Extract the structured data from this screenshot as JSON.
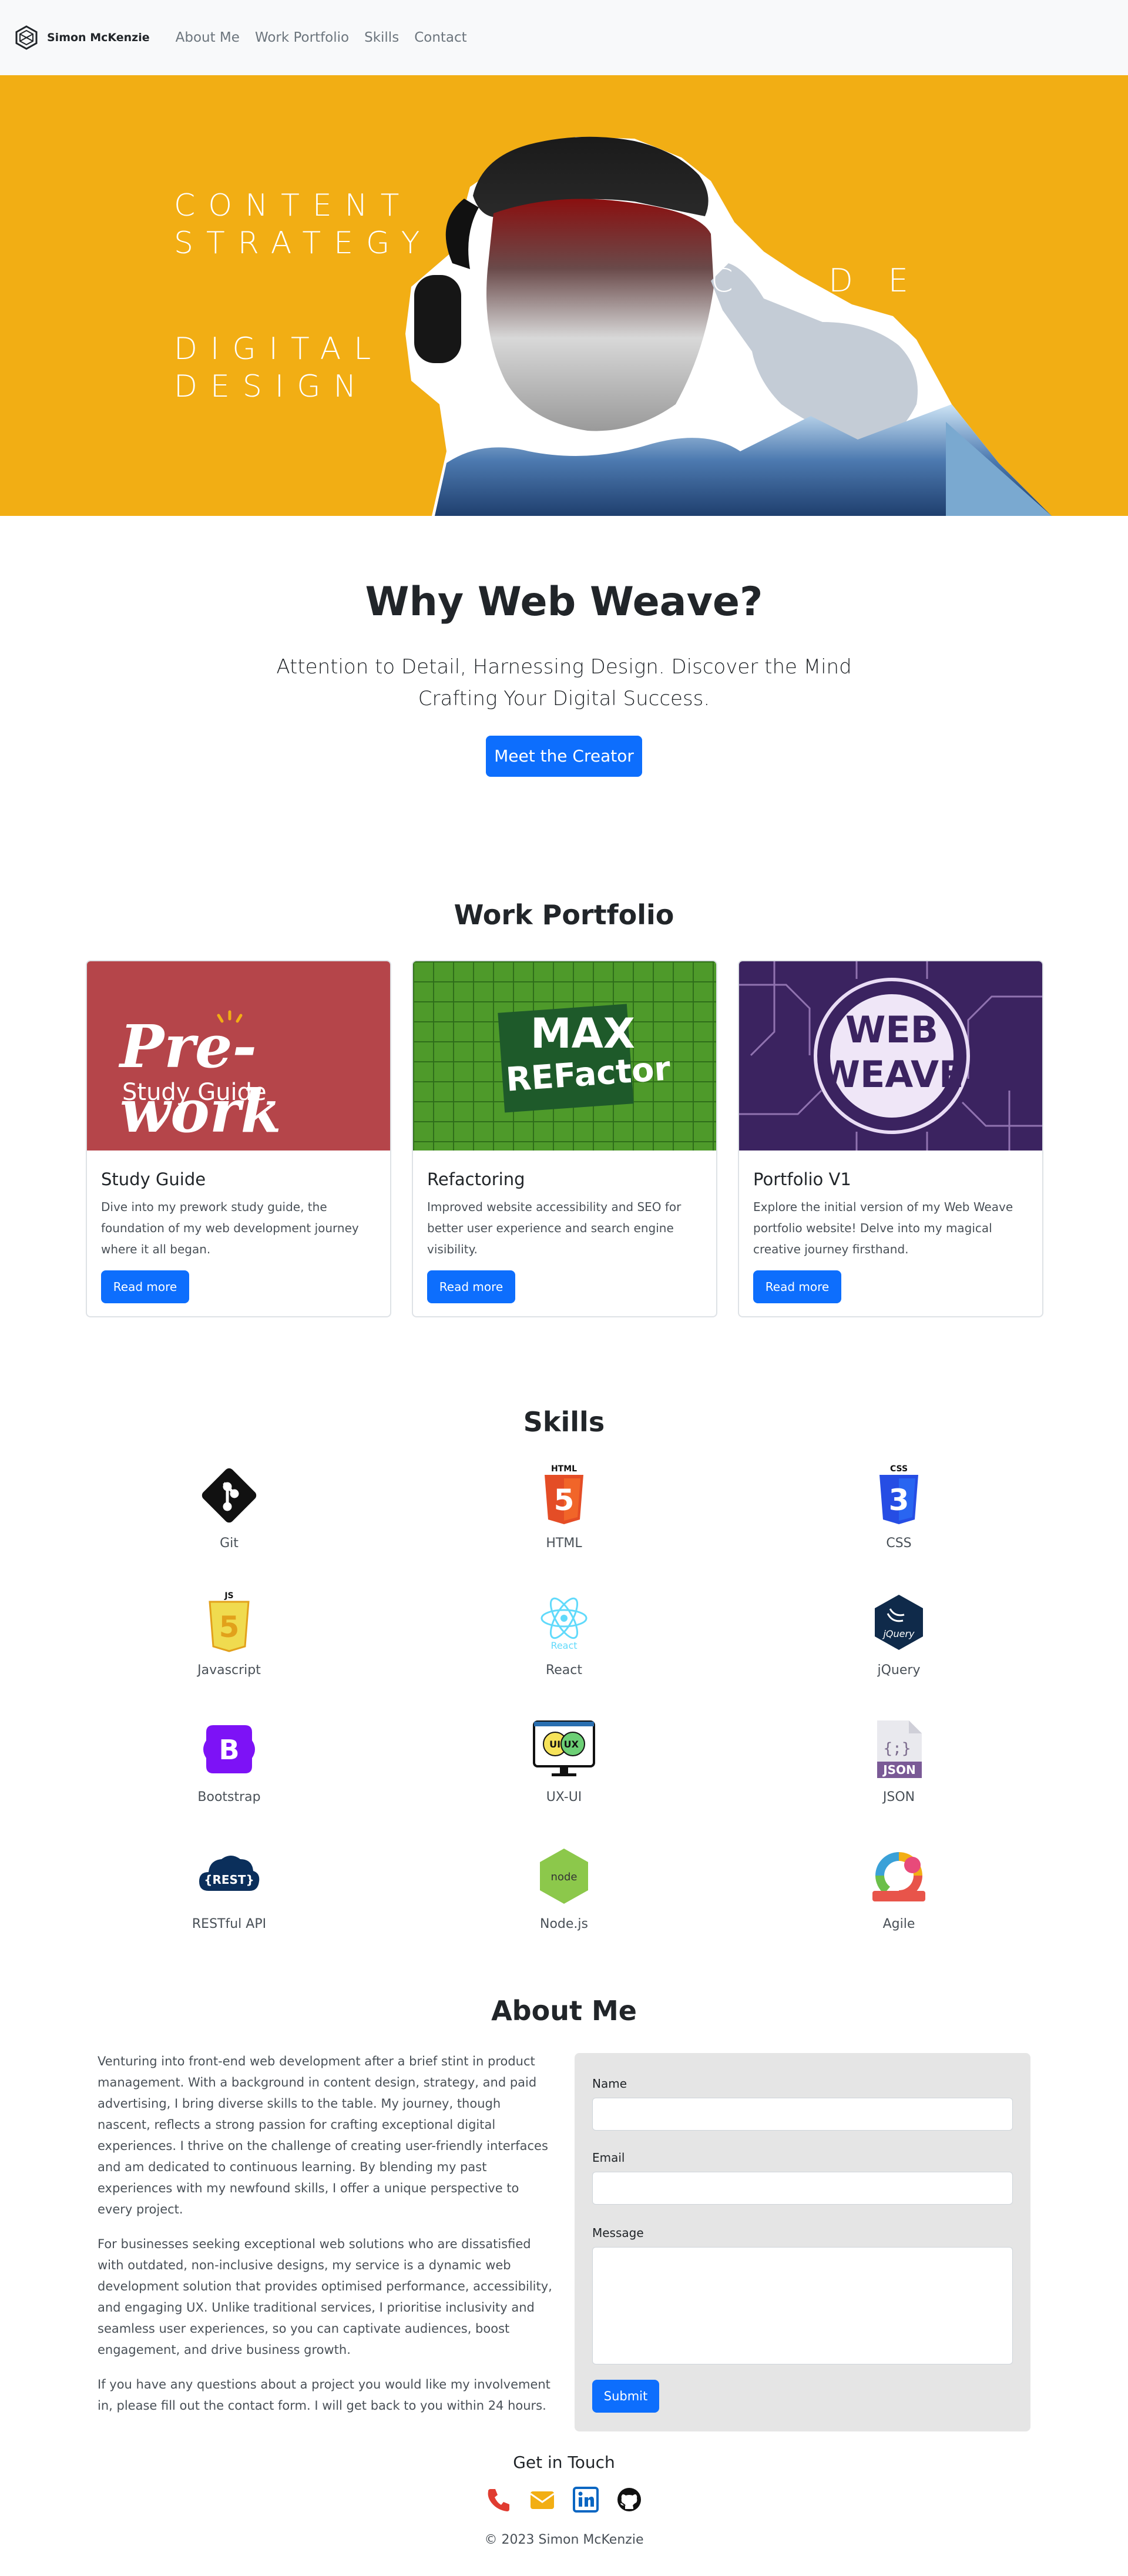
{
  "nav": {
    "brand": "Simon McKenzie",
    "links": [
      "About Me",
      "Work Portfolio",
      "Skills",
      "Contact"
    ]
  },
  "hero": {
    "word1": "CONTENT\nSTRATEGY",
    "word2": "DIGITAL\nDESIGN",
    "word3": "CODE"
  },
  "why": {
    "title": "Why Web Weave?",
    "subtitle": "Attention to Detail, Harnessing Design. Discover the Mind Crafting Your Digital Success.",
    "button": "Meet the Creator"
  },
  "portfolio": {
    "title": "Work Portfolio",
    "cards": [
      {
        "image_text1": "Pre-work",
        "image_text2": "Study Guide",
        "title": "Study Guide",
        "text": "Dive into my prework study guide, the foundation of my web development journey where it all began.",
        "button": "Read more"
      },
      {
        "image_text1": "MAX",
        "image_text2": "REFactor",
        "title": "Refactoring",
        "text": "Improved website accessibility and SEO for better user experience and search engine visibility.",
        "button": "Read more"
      },
      {
        "image_text1": "WEB",
        "image_text2": "WEAVE",
        "title": "Portfolio V1",
        "text": "Explore the initial version of my Web Weave portfolio website! Delve into my magical creative journey firsthand.",
        "button": "Read more"
      }
    ]
  },
  "skills": {
    "title": "Skills",
    "items": [
      {
        "label": "Git",
        "icon": "git-icon",
        "badge": ""
      },
      {
        "label": "HTML",
        "icon": "html5-icon",
        "badge": "HTML"
      },
      {
        "label": "CSS",
        "icon": "css3-icon",
        "badge": "CSS"
      },
      {
        "label": "Javascript",
        "icon": "javascript-icon",
        "badge": "JS"
      },
      {
        "label": "React",
        "icon": "react-icon",
        "badge": "React"
      },
      {
        "label": "jQuery",
        "icon": "jquery-icon",
        "badge": "jQuery"
      },
      {
        "label": "Bootstrap",
        "icon": "bootstrap-icon",
        "badge": "B"
      },
      {
        "label": "UX-UI",
        "icon": "ux-ui-icon",
        "badge": "UI UX"
      },
      {
        "label": "JSON",
        "icon": "json-icon",
        "badge": "JSON"
      },
      {
        "label": "RESTful API",
        "icon": "rest-api-icon",
        "badge": "{REST}"
      },
      {
        "label": "Node.js",
        "icon": "nodejs-icon",
        "badge": "node"
      },
      {
        "label": "Agile",
        "icon": "agile-icon",
        "badge": ""
      }
    ]
  },
  "about": {
    "title": "About Me",
    "paragraphs": [
      "Venturing into front-end web development after a brief stint in product management. With a background in content design, strategy, and paid advertising, I bring diverse skills to the table. My journey, though nascent, reflects a strong passion for crafting exceptional digital experiences. I thrive on the challenge of creating user-friendly interfaces and am dedicated to continuous learning. By blending my past experiences with my newfound skills, I offer a unique perspective to every project.",
      "For businesses seeking exceptional web solutions who are dissatisfied with outdated, non-inclusive designs, my service is a dynamic web development solution that provides optimised performance, accessibility, and engaging UX. Unlike traditional services, I prioritise inclusivity and seamless user experiences, so you can captivate audiences, boost engagement, and drive business growth.",
      "If you have any questions about a project you would like my involvement in, please fill out the contact form. I will get back to you within 24 hours."
    ]
  },
  "form": {
    "name_label": "Name",
    "email_label": "Email",
    "message_label": "Message",
    "submit": "Submit"
  },
  "footer": {
    "title": "Get in Touch",
    "copyright": "© 2023 Simon McKenzie"
  },
  "colors": {
    "hero_bg": "#f2ae14",
    "primary": "#0d6efd",
    "form_bg": "#e5e5e5"
  }
}
